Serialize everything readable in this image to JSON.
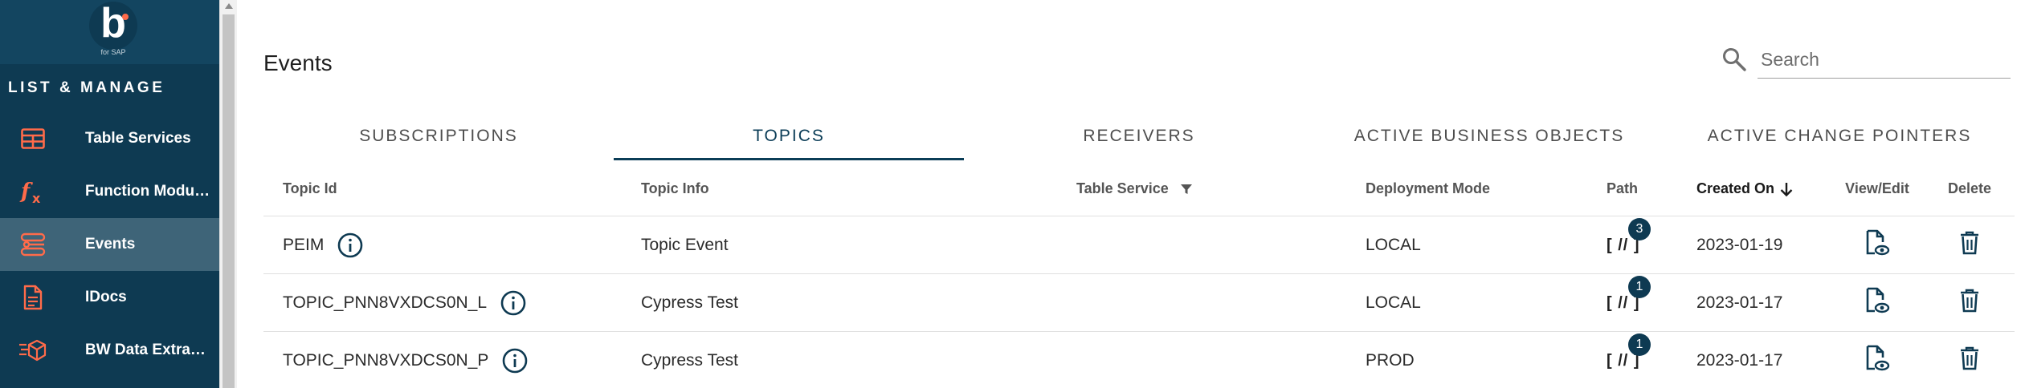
{
  "brand": {
    "letter": "b",
    "sub": "for SAP"
  },
  "sidebar": {
    "section_title": "LIST & MANAGE",
    "items": [
      {
        "label": "Table Services",
        "icon": "table-icon",
        "active": false
      },
      {
        "label": "Function Modul…",
        "icon": "function-icon",
        "active": false
      },
      {
        "label": "Events",
        "icon": "events-icon",
        "active": true
      },
      {
        "label": "IDocs",
        "icon": "document-icon",
        "active": false
      },
      {
        "label": "BW Data Extract…",
        "icon": "bw-extract-icon",
        "active": false
      }
    ]
  },
  "header": {
    "title": "Events"
  },
  "search": {
    "placeholder": "Search",
    "value": ""
  },
  "tabs": [
    {
      "label": "SUBSCRIPTIONS",
      "active": false
    },
    {
      "label": "TOPICS",
      "active": true
    },
    {
      "label": "RECEIVERS",
      "active": false
    },
    {
      "label": "ACTIVE BUSINESS OBJECTS",
      "active": false
    },
    {
      "label": "ACTIVE CHANGE POINTERS",
      "active": false
    }
  ],
  "table": {
    "columns": {
      "topic_id": "Topic Id",
      "topic_info": "Topic Info",
      "table_service": "Table Service",
      "deployment_mode": "Deployment Mode",
      "path": "Path",
      "created_on": "Created On",
      "view_edit": "View/Edit",
      "delete": "Delete"
    },
    "rows": [
      {
        "topic_id": "PEIM",
        "topic_info": "Topic Event",
        "table_service": "",
        "deployment_mode": "LOCAL",
        "path": "[ // ]",
        "path_count": "3",
        "created_on": "2023-01-19"
      },
      {
        "topic_id": "TOPIC_PNN8VXDCS0N_L",
        "topic_info": "Cypress Test",
        "table_service": "",
        "deployment_mode": "LOCAL",
        "path": "[ // ]",
        "path_count": "1",
        "created_on": "2023-01-17"
      },
      {
        "topic_id": "TOPIC_PNN8VXDCS0N_P",
        "topic_info": "Cypress Test",
        "table_service": "",
        "deployment_mode": "PROD",
        "path": "[ // ]",
        "path_count": "1",
        "created_on": "2023-01-17"
      }
    ]
  },
  "colors": {
    "sidebar_bg": "#0e3a52",
    "sidebar_active": "#3e6478",
    "accent": "#0b3d57",
    "icon_coral": "#ff6b4a"
  }
}
